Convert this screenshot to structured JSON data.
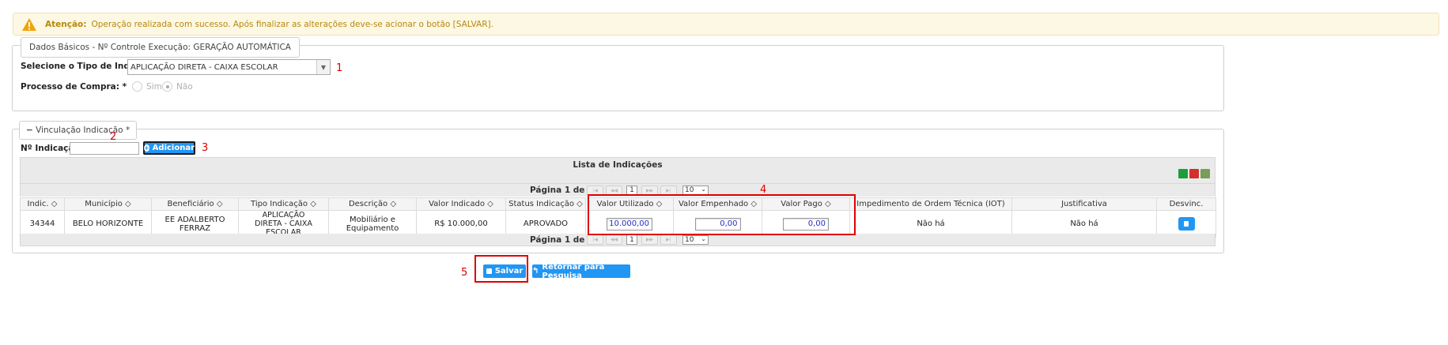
{
  "alert": {
    "title": "Atenção:",
    "text": "Operação realizada com sucesso. Após finalizar as alterações deve-se acionar o botão [SALVAR]."
  },
  "dados_basicos": {
    "legend": "Dados Básicos - Nº Controle Execução: GERAÇÃO AUTOMÁTICA",
    "tipo_label": "Selecione o Tipo de Indicação: *",
    "tipo_value": "APLICAÇÃO DIRETA - CAIXA ESCOLAR",
    "processo_label": "Processo de Compra: *",
    "radio_sim": "Sim",
    "radio_nao": "Não"
  },
  "vinculacao": {
    "legend": "Vinculação Indicação *",
    "collapse_symbol": "−",
    "n_indicacao_label": "Nº Indicação:",
    "n_indicacao_value": "",
    "add_label": "Adicionar"
  },
  "grid": {
    "title": "Lista de Indicações",
    "page_label": "Página 1 de 1",
    "current_page": "1",
    "page_size": "10",
    "columns": [
      "Indic. ◇",
      "Município ◇",
      "Beneficiário ◇",
      "Tipo Indicação ◇",
      "Descrição ◇",
      "Valor Indicado ◇",
      "Status Indicação ◇",
      "Valor Utilizado ◇",
      "Valor Empenhado ◇",
      "Valor Pago ◇",
      "Impedimento de Ordem Técnica (IOT)",
      "Justificativa",
      "Desvinc."
    ],
    "rows": [
      {
        "indic": "34344",
        "municipio": "BELO HORIZONTE",
        "beneficiario": "EE ADALBERTO FERRAZ",
        "tipo": "APLICAÇÃO DIRETA - CAIXA ESCOLAR",
        "descricao": "Mobiliário e Equipamento",
        "valor_indicado": "R$ 10.000,00",
        "status": "APROVADO",
        "valor_utilizado": "10.000,00",
        "valor_empenhado": "0,00",
        "valor_pago": "0,00",
        "iot": "Não há",
        "justificativa": "Não há"
      }
    ]
  },
  "buttons": {
    "salvar": "Salvar",
    "retornar": "Retornar para Pesquisa"
  },
  "annotations": [
    "1",
    "2",
    "3",
    "4",
    "5"
  ],
  "colors": {
    "accent": "#2196f3",
    "annotation_red": "#e00000",
    "alert_bg": "#fcf8e3",
    "alert_text": "#b7870f"
  }
}
